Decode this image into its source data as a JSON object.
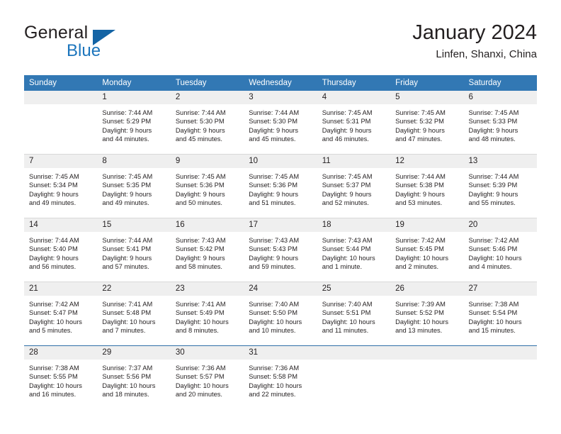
{
  "brand": {
    "name_primary": "General",
    "name_secondary": "Blue",
    "accent_color": "#1464a5",
    "blue_text_color": "#1c75bc"
  },
  "header": {
    "title": "January 2024",
    "subtitle": "Linfen, Shanxi, China"
  },
  "calendar": {
    "header_bg": "#3278b4",
    "daynum_bg": "#efefef",
    "weekday_headers": [
      "Sunday",
      "Monday",
      "Tuesday",
      "Wednesday",
      "Thursday",
      "Friday",
      "Saturday"
    ],
    "weeks": [
      [
        {
          "day": "",
          "empty": true,
          "lines": []
        },
        {
          "day": "1",
          "lines": [
            "Sunrise: 7:44 AM",
            "Sunset: 5:29 PM",
            "Daylight: 9 hours",
            "and 44 minutes."
          ]
        },
        {
          "day": "2",
          "lines": [
            "Sunrise: 7:44 AM",
            "Sunset: 5:30 PM",
            "Daylight: 9 hours",
            "and 45 minutes."
          ]
        },
        {
          "day": "3",
          "lines": [
            "Sunrise: 7:44 AM",
            "Sunset: 5:30 PM",
            "Daylight: 9 hours",
            "and 45 minutes."
          ]
        },
        {
          "day": "4",
          "lines": [
            "Sunrise: 7:45 AM",
            "Sunset: 5:31 PM",
            "Daylight: 9 hours",
            "and 46 minutes."
          ]
        },
        {
          "day": "5",
          "lines": [
            "Sunrise: 7:45 AM",
            "Sunset: 5:32 PM",
            "Daylight: 9 hours",
            "and 47 minutes."
          ]
        },
        {
          "day": "6",
          "lines": [
            "Sunrise: 7:45 AM",
            "Sunset: 5:33 PM",
            "Daylight: 9 hours",
            "and 48 minutes."
          ]
        }
      ],
      [
        {
          "day": "7",
          "lines": [
            "Sunrise: 7:45 AM",
            "Sunset: 5:34 PM",
            "Daylight: 9 hours",
            "and 49 minutes."
          ]
        },
        {
          "day": "8",
          "lines": [
            "Sunrise: 7:45 AM",
            "Sunset: 5:35 PM",
            "Daylight: 9 hours",
            "and 49 minutes."
          ]
        },
        {
          "day": "9",
          "lines": [
            "Sunrise: 7:45 AM",
            "Sunset: 5:36 PM",
            "Daylight: 9 hours",
            "and 50 minutes."
          ]
        },
        {
          "day": "10",
          "lines": [
            "Sunrise: 7:45 AM",
            "Sunset: 5:36 PM",
            "Daylight: 9 hours",
            "and 51 minutes."
          ]
        },
        {
          "day": "11",
          "lines": [
            "Sunrise: 7:45 AM",
            "Sunset: 5:37 PM",
            "Daylight: 9 hours",
            "and 52 minutes."
          ]
        },
        {
          "day": "12",
          "lines": [
            "Sunrise: 7:44 AM",
            "Sunset: 5:38 PM",
            "Daylight: 9 hours",
            "and 53 minutes."
          ]
        },
        {
          "day": "13",
          "lines": [
            "Sunrise: 7:44 AM",
            "Sunset: 5:39 PM",
            "Daylight: 9 hours",
            "and 55 minutes."
          ]
        }
      ],
      [
        {
          "day": "14",
          "lines": [
            "Sunrise: 7:44 AM",
            "Sunset: 5:40 PM",
            "Daylight: 9 hours",
            "and 56 minutes."
          ]
        },
        {
          "day": "15",
          "lines": [
            "Sunrise: 7:44 AM",
            "Sunset: 5:41 PM",
            "Daylight: 9 hours",
            "and 57 minutes."
          ]
        },
        {
          "day": "16",
          "lines": [
            "Sunrise: 7:43 AM",
            "Sunset: 5:42 PM",
            "Daylight: 9 hours",
            "and 58 minutes."
          ]
        },
        {
          "day": "17",
          "lines": [
            "Sunrise: 7:43 AM",
            "Sunset: 5:43 PM",
            "Daylight: 9 hours",
            "and 59 minutes."
          ]
        },
        {
          "day": "18",
          "lines": [
            "Sunrise: 7:43 AM",
            "Sunset: 5:44 PM",
            "Daylight: 10 hours",
            "and 1 minute."
          ]
        },
        {
          "day": "19",
          "lines": [
            "Sunrise: 7:42 AM",
            "Sunset: 5:45 PM",
            "Daylight: 10 hours",
            "and 2 minutes."
          ]
        },
        {
          "day": "20",
          "lines": [
            "Sunrise: 7:42 AM",
            "Sunset: 5:46 PM",
            "Daylight: 10 hours",
            "and 4 minutes."
          ]
        }
      ],
      [
        {
          "day": "21",
          "lines": [
            "Sunrise: 7:42 AM",
            "Sunset: 5:47 PM",
            "Daylight: 10 hours",
            "and 5 minutes."
          ]
        },
        {
          "day": "22",
          "lines": [
            "Sunrise: 7:41 AM",
            "Sunset: 5:48 PM",
            "Daylight: 10 hours",
            "and 7 minutes."
          ]
        },
        {
          "day": "23",
          "lines": [
            "Sunrise: 7:41 AM",
            "Sunset: 5:49 PM",
            "Daylight: 10 hours",
            "and 8 minutes."
          ]
        },
        {
          "day": "24",
          "lines": [
            "Sunrise: 7:40 AM",
            "Sunset: 5:50 PM",
            "Daylight: 10 hours",
            "and 10 minutes."
          ]
        },
        {
          "day": "25",
          "lines": [
            "Sunrise: 7:40 AM",
            "Sunset: 5:51 PM",
            "Daylight: 10 hours",
            "and 11 minutes."
          ]
        },
        {
          "day": "26",
          "lines": [
            "Sunrise: 7:39 AM",
            "Sunset: 5:52 PM",
            "Daylight: 10 hours",
            "and 13 minutes."
          ]
        },
        {
          "day": "27",
          "lines": [
            "Sunrise: 7:38 AM",
            "Sunset: 5:54 PM",
            "Daylight: 10 hours",
            "and 15 minutes."
          ]
        }
      ],
      [
        {
          "day": "28",
          "lines": [
            "Sunrise: 7:38 AM",
            "Sunset: 5:55 PM",
            "Daylight: 10 hours",
            "and 16 minutes."
          ]
        },
        {
          "day": "29",
          "lines": [
            "Sunrise: 7:37 AM",
            "Sunset: 5:56 PM",
            "Daylight: 10 hours",
            "and 18 minutes."
          ]
        },
        {
          "day": "30",
          "lines": [
            "Sunrise: 7:36 AM",
            "Sunset: 5:57 PM",
            "Daylight: 10 hours",
            "and 20 minutes."
          ]
        },
        {
          "day": "31",
          "lines": [
            "Sunrise: 7:36 AM",
            "Sunset: 5:58 PM",
            "Daylight: 10 hours",
            "and 22 minutes."
          ]
        },
        {
          "day": "",
          "empty": true,
          "lines": []
        },
        {
          "day": "",
          "empty": true,
          "lines": []
        },
        {
          "day": "",
          "empty": true,
          "lines": []
        }
      ]
    ]
  }
}
